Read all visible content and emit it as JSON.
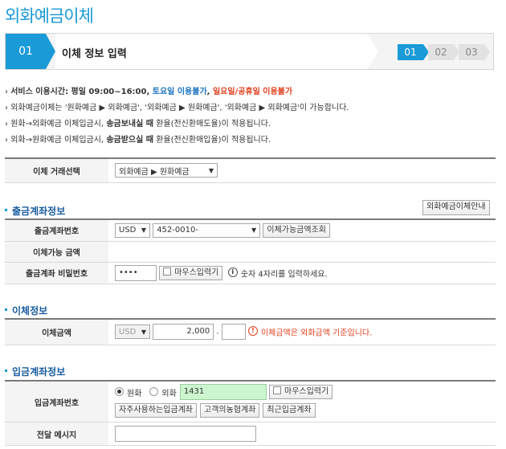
{
  "page": {
    "title": "외화예금이체"
  },
  "stepbar": {
    "current_number": "01",
    "current_label": "이체 정보 입력",
    "steps": [
      "01",
      "02",
      "03"
    ]
  },
  "notices": [
    {
      "text": "서비스 이용시간: 평일 09:00~16:00, ",
      "blue": "토요일 이용불가",
      "sep": ", ",
      "red": "일요일/공휴일 이용불가"
    },
    {
      "text": "외화예금이체는 '원화예금 ▶ 외화예금', '외화예금 ▶ 원화예금', '외화예금 ▶ 외화예금'이 가능합니다."
    },
    {
      "pre": "원화→외화예금 이체입금시, ",
      "bold": "송금보내실 때",
      "post": " 환율(전신환매도율)이 적용됩니다."
    },
    {
      "pre": "외화→원화예금 이체입금시, ",
      "bold": "송금받으실 때",
      "post": " 환율(전신환매입율)이 적용됩니다."
    }
  ],
  "transfer_type": {
    "label": "이체 거래선택",
    "selected": "외화예금 ▶ 원화예금"
  },
  "withdraw": {
    "section_title": "출금계좌정보",
    "guide_button": "외화예금이체안내",
    "account_label": "출금계좌번호",
    "currency": "USD",
    "account_number": "452-0010-",
    "limit_button": "이체가능금액조회",
    "available_label": "이체가능 금액",
    "password_label": "출금계좌 비밀번호",
    "password_value": "••••",
    "mouse_input_label": "마우스입력기",
    "password_help": "숫자 4자리를 입력하세요."
  },
  "transfer_info": {
    "section_title": "이체정보",
    "amount_label": "이체금액",
    "currency": "USD",
    "amount_integer": "2,000",
    "amount_separator": ".",
    "amount_decimal": "",
    "amount_help": "이체금액은 외화금액 기준입니다."
  },
  "deposit": {
    "section_title": "입금계좌정보",
    "account_label": "입금계좌번호",
    "radio_krw": "원화",
    "radio_fx": "외화",
    "account_value": "1431",
    "mouse_input_label": "마우스입력기",
    "btn_frequent": "자주사용하는입금계좌",
    "btn_customer": "고객의농협계좌",
    "btn_recent": "최근입금계좌",
    "message_label": "전달 메시지",
    "message_value": ""
  }
}
